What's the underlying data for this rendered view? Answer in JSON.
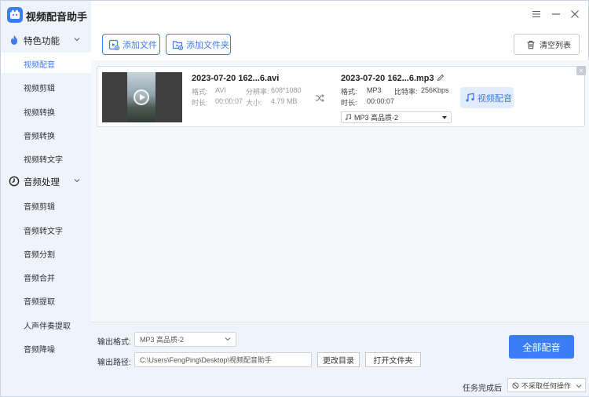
{
  "app": {
    "title": "视频配音助手",
    "accent": "#3c7cf6"
  },
  "window": {
    "menu_icon": "menu-icon",
    "minimize_icon": "minimize-icon",
    "close_icon": "close-icon"
  },
  "sidebar": {
    "groups": [
      {
        "label": "特色功能",
        "icon": "flame-icon",
        "items": [
          "视频配音",
          "视频剪辑",
          "视频转换",
          "音频转换",
          "视频转文字"
        ],
        "active_item": "视频配音"
      },
      {
        "label": "音频处理",
        "icon": "clock-icon",
        "items": [
          "音频剪辑",
          "音频转文字",
          "音频分割",
          "音频合并",
          "音频提取",
          "人声伴奏提取",
          "音频降噪"
        ]
      }
    ]
  },
  "toolbar": {
    "add_file": "添加文件",
    "add_folder": "添加文件夹",
    "clear_list": "清空列表"
  },
  "file_item": {
    "source": {
      "name": "2023-07-20 162...6.avi",
      "format_label": "格式:",
      "format": "AVI",
      "resolution_label": "分辨率:",
      "resolution": "608*1080",
      "duration_label": "时长:",
      "duration": "00:00:07",
      "size_label": "大小:",
      "size": "4.79 MB"
    },
    "output": {
      "name": "2023-07-20 162...6.mp3",
      "format_label": "格式:",
      "format": "MP3",
      "bitrate_label": "比特率:",
      "bitrate": "256Kbps",
      "duration_label": "时长:",
      "duration": "00:00:07",
      "quality_select": "MP3   高品质-2"
    },
    "dub_button": "视频配音",
    "remove": "×"
  },
  "footer": {
    "output_format_label": "输出格式:",
    "output_format_value": "MP3   高品质-2",
    "output_path_label": "输出路径:",
    "output_path_value": "C:\\Users\\FengPing\\Desktop\\视频配音助手",
    "change_dir": "更改目录",
    "open_folder": "打开文件夹",
    "convert_all": "全部配音",
    "after_task_label": "任务完成后",
    "after_task_value": "不采取任何操作"
  }
}
